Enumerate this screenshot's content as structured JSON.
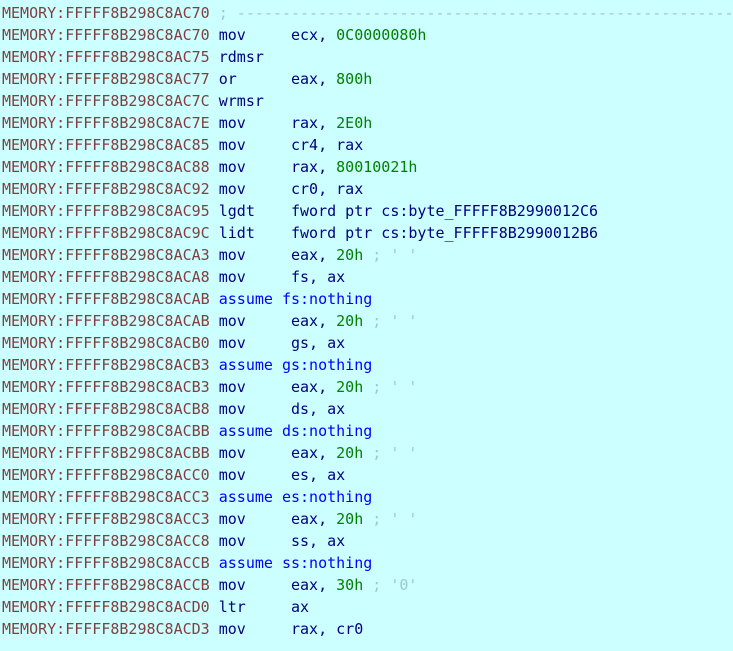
{
  "view": {
    "name": "IDA View-A disassembly listing",
    "segment_prefix": "MEMORY:",
    "background_color": "#CCFFFF",
    "address_color": "#804040",
    "mnemonic_color": "#000080",
    "number_color": "#008000",
    "assume_color": "#0000FF",
    "comment_color": "#9FC8C8"
  },
  "lines": [
    {
      "address": "MEMORY:FFFFF8B298C8AC70",
      "kind": "comment",
      "comment": "; ------------------------------------------------------------"
    },
    {
      "address": "MEMORY:FFFFF8B298C8AC70",
      "kind": "insn",
      "mnemonic": "mov",
      "operand_pre": "ecx, ",
      "number": "0C0000080h",
      "operand_post": "",
      "comment": ""
    },
    {
      "address": "MEMORY:FFFFF8B298C8AC75",
      "kind": "insn",
      "mnemonic": "rdmsr",
      "operand_pre": "",
      "number": "",
      "operand_post": "",
      "comment": ""
    },
    {
      "address": "MEMORY:FFFFF8B298C8AC77",
      "kind": "insn",
      "mnemonic": "or",
      "operand_pre": "eax, ",
      "number": "800h",
      "operand_post": "",
      "comment": ""
    },
    {
      "address": "MEMORY:FFFFF8B298C8AC7C",
      "kind": "insn",
      "mnemonic": "wrmsr",
      "operand_pre": "",
      "number": "",
      "operand_post": "",
      "comment": ""
    },
    {
      "address": "MEMORY:FFFFF8B298C8AC7E",
      "kind": "insn",
      "mnemonic": "mov",
      "operand_pre": "rax, ",
      "number": "2E0h",
      "operand_post": "",
      "comment": ""
    },
    {
      "address": "MEMORY:FFFFF8B298C8AC85",
      "kind": "insn",
      "mnemonic": "mov",
      "operand_pre": "cr4, rax",
      "number": "",
      "operand_post": "",
      "comment": ""
    },
    {
      "address": "MEMORY:FFFFF8B298C8AC88",
      "kind": "insn",
      "mnemonic": "mov",
      "operand_pre": "rax, ",
      "number": "80010021h",
      "operand_post": "",
      "comment": ""
    },
    {
      "address": "MEMORY:FFFFF8B298C8AC92",
      "kind": "insn",
      "mnemonic": "mov",
      "operand_pre": "cr0, rax",
      "number": "",
      "operand_post": "",
      "comment": ""
    },
    {
      "address": "MEMORY:FFFFF8B298C8AC95",
      "kind": "insn",
      "mnemonic": "lgdt",
      "operand_pre": "fword ptr cs:byte_FFFFF8B2990012C6",
      "number": "",
      "operand_post": "",
      "comment": ""
    },
    {
      "address": "MEMORY:FFFFF8B298C8AC9C",
      "kind": "insn",
      "mnemonic": "lidt",
      "operand_pre": "fword ptr cs:byte_FFFFF8B2990012B6",
      "number": "",
      "operand_post": "",
      "comment": ""
    },
    {
      "address": "MEMORY:FFFFF8B298C8ACA3",
      "kind": "insn",
      "mnemonic": "mov",
      "operand_pre": "eax, ",
      "number": "20h",
      "operand_post": "",
      "comment": " ; ' '"
    },
    {
      "address": "MEMORY:FFFFF8B298C8ACA8",
      "kind": "insn",
      "mnemonic": "mov",
      "operand_pre": "fs, ax",
      "number": "",
      "operand_post": "",
      "comment": ""
    },
    {
      "address": "MEMORY:FFFFF8B298C8ACAB",
      "kind": "assume",
      "text": "assume fs:nothing"
    },
    {
      "address": "MEMORY:FFFFF8B298C8ACAB",
      "kind": "insn",
      "mnemonic": "mov",
      "operand_pre": "eax, ",
      "number": "20h",
      "operand_post": "",
      "comment": " ; ' '"
    },
    {
      "address": "MEMORY:FFFFF8B298C8ACB0",
      "kind": "insn",
      "mnemonic": "mov",
      "operand_pre": "gs, ax",
      "number": "",
      "operand_post": "",
      "comment": ""
    },
    {
      "address": "MEMORY:FFFFF8B298C8ACB3",
      "kind": "assume",
      "text": "assume gs:nothing"
    },
    {
      "address": "MEMORY:FFFFF8B298C8ACB3",
      "kind": "insn",
      "mnemonic": "mov",
      "operand_pre": "eax, ",
      "number": "20h",
      "operand_post": "",
      "comment": " ; ' '"
    },
    {
      "address": "MEMORY:FFFFF8B298C8ACB8",
      "kind": "insn",
      "mnemonic": "mov",
      "operand_pre": "ds, ax",
      "number": "",
      "operand_post": "",
      "comment": ""
    },
    {
      "address": "MEMORY:FFFFF8B298C8ACBB",
      "kind": "assume",
      "text": "assume ds:nothing"
    },
    {
      "address": "MEMORY:FFFFF8B298C8ACBB",
      "kind": "insn",
      "mnemonic": "mov",
      "operand_pre": "eax, ",
      "number": "20h",
      "operand_post": "",
      "comment": " ; ' '"
    },
    {
      "address": "MEMORY:FFFFF8B298C8ACC0",
      "kind": "insn",
      "mnemonic": "mov",
      "operand_pre": "es, ax",
      "number": "",
      "operand_post": "",
      "comment": ""
    },
    {
      "address": "MEMORY:FFFFF8B298C8ACC3",
      "kind": "assume",
      "text": "assume es:nothing"
    },
    {
      "address": "MEMORY:FFFFF8B298C8ACC3",
      "kind": "insn",
      "mnemonic": "mov",
      "operand_pre": "eax, ",
      "number": "20h",
      "operand_post": "",
      "comment": " ; ' '"
    },
    {
      "address": "MEMORY:FFFFF8B298C8ACC8",
      "kind": "insn",
      "mnemonic": "mov",
      "operand_pre": "ss, ax",
      "number": "",
      "operand_post": "",
      "comment": ""
    },
    {
      "address": "MEMORY:FFFFF8B298C8ACCB",
      "kind": "assume",
      "text": "assume ss:nothing"
    },
    {
      "address": "MEMORY:FFFFF8B298C8ACCB",
      "kind": "insn",
      "mnemonic": "mov",
      "operand_pre": "eax, ",
      "number": "30h",
      "operand_post": "",
      "comment": " ; '0'"
    },
    {
      "address": "MEMORY:FFFFF8B298C8ACD0",
      "kind": "insn",
      "mnemonic": "ltr",
      "operand_pre": "ax",
      "number": "",
      "operand_post": "",
      "comment": ""
    },
    {
      "address": "MEMORY:FFFFF8B298C8ACD3",
      "kind": "insn",
      "mnemonic": "mov",
      "operand_pre": "rax, cr0",
      "number": "",
      "operand_post": "",
      "comment": ""
    }
  ]
}
